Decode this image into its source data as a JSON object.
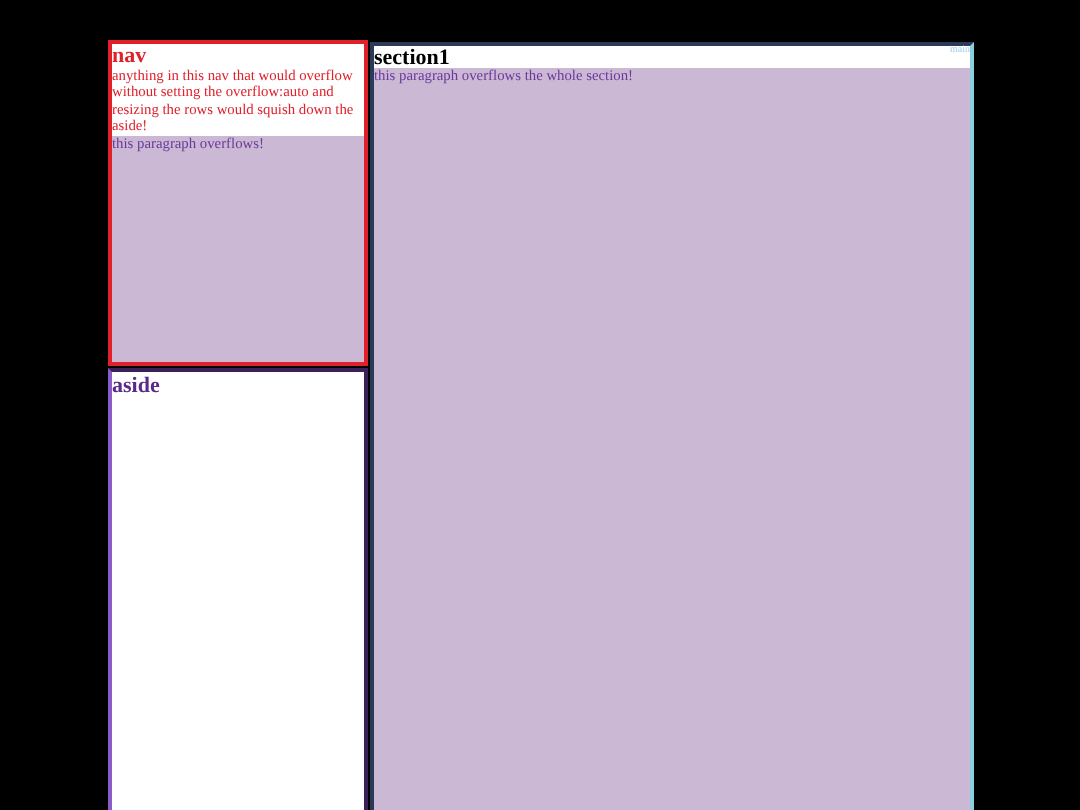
{
  "nav": {
    "heading": "nav",
    "text": "anything in this nav that would overflow without setting the overflow:auto and resizing the rows would squish down the aside!",
    "overflow_paragraph": "this paragraph overflows!"
  },
  "aside": {
    "heading": "aside"
  },
  "main": {
    "label": "main",
    "heading": "section1",
    "paragraph": "this paragraph overflows the whole section!"
  }
}
